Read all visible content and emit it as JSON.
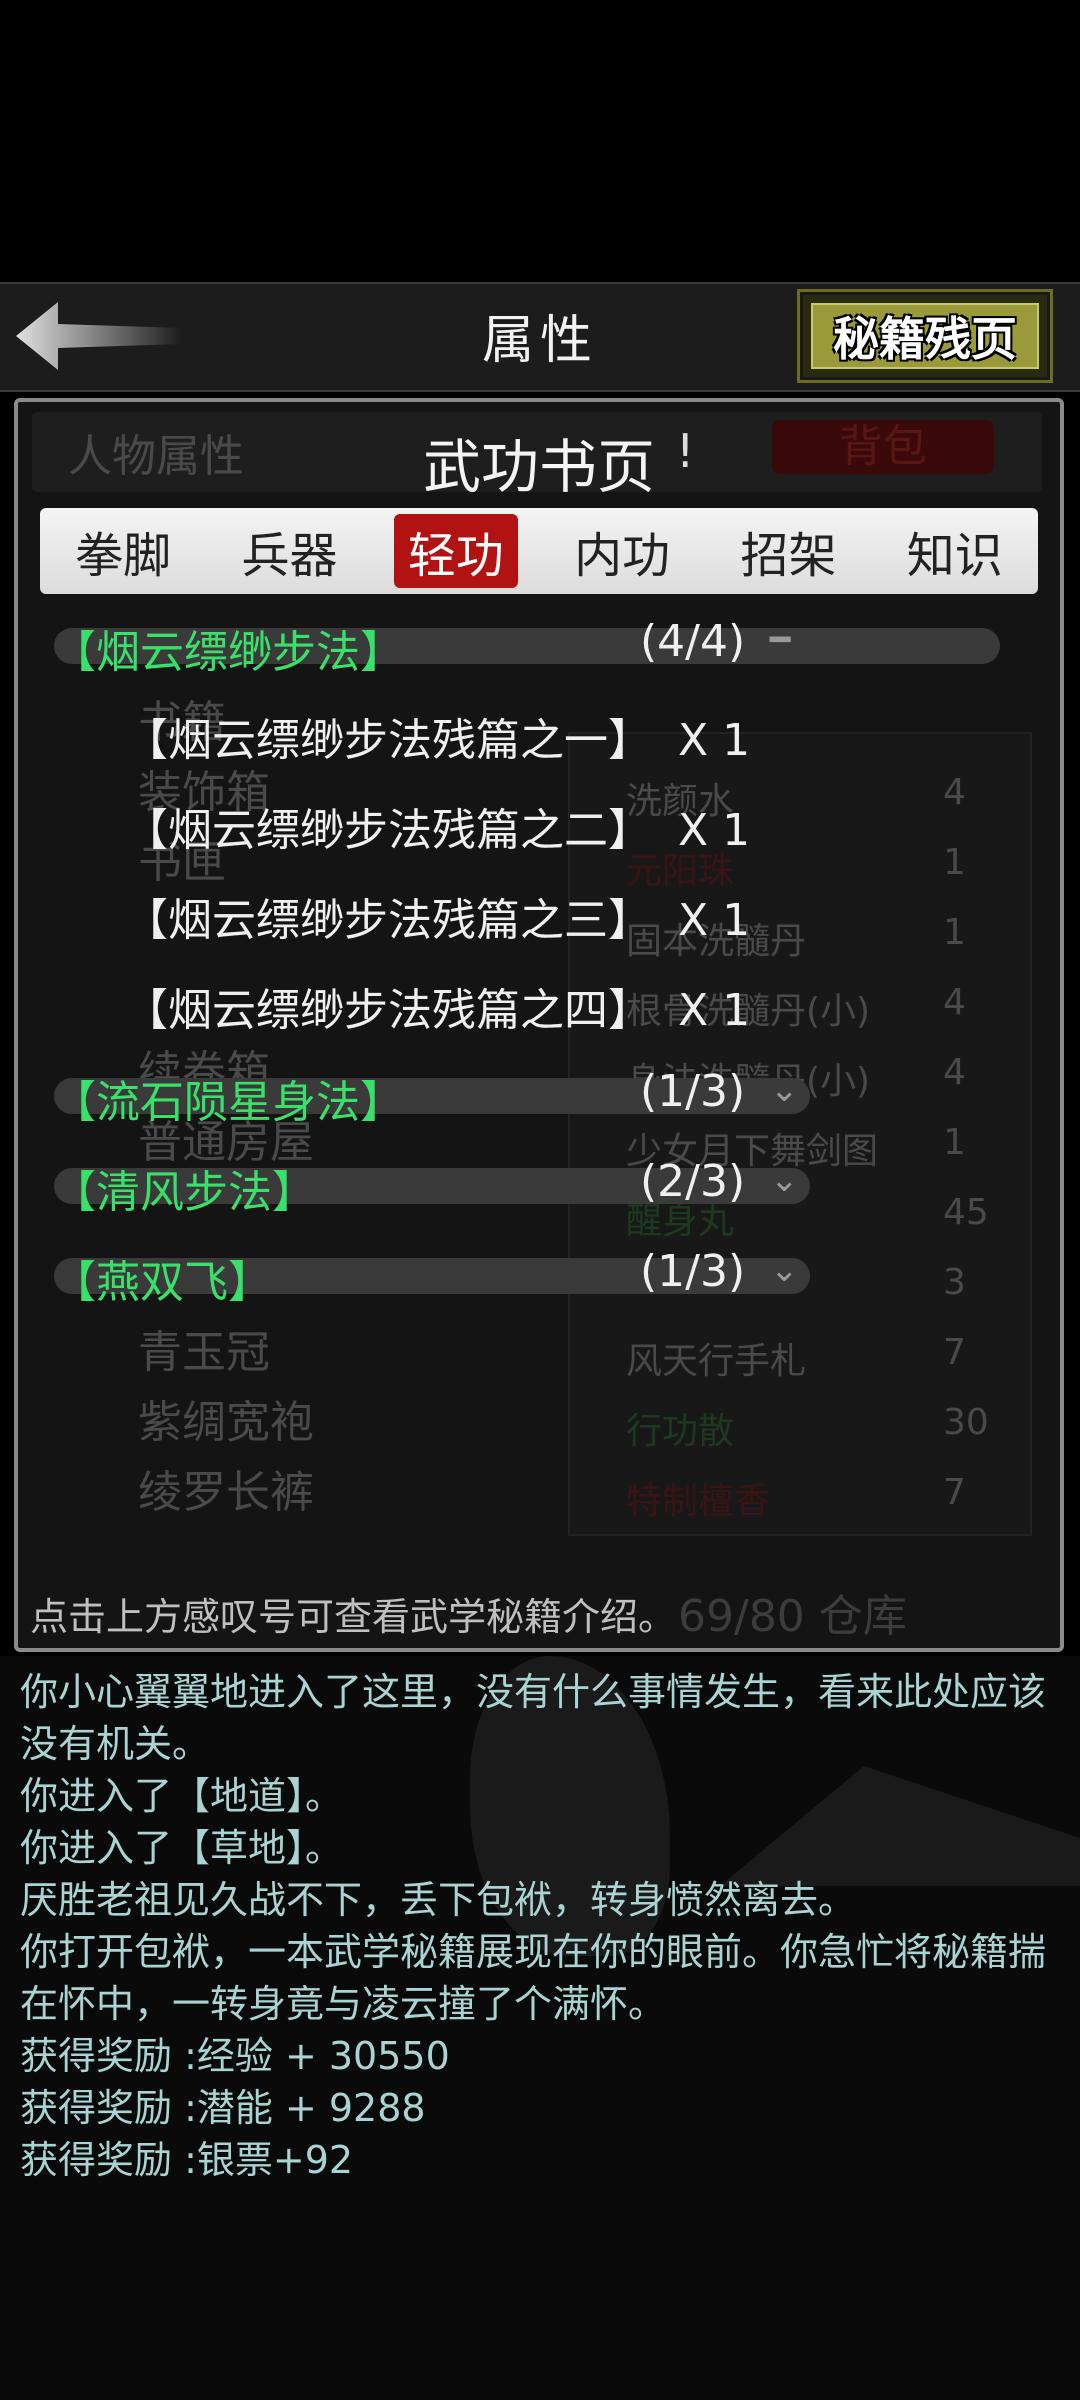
{
  "header": {
    "title": "属性",
    "fragments_button": "秘籍残页"
  },
  "background": {
    "tab_attributes": "人物属性",
    "tab_bag": "背包",
    "equip_list": [
      "书籍",
      "装饰箱",
      "书匣",
      "续卷箱",
      "普通房屋",
      "青玉冠",
      "紫绸宽袍",
      "绫罗长裤"
    ],
    "inventory": [
      {
        "name": "洗颜水",
        "count": "4"
      },
      {
        "name": "元阳珠",
        "count": "1"
      },
      {
        "name": "固本洗髓丹",
        "count": "1"
      },
      {
        "name": "根骨洗髓丹(小)",
        "count": "4"
      },
      {
        "name": "身法洗髓丹(小)",
        "count": "4"
      },
      {
        "name": "少女月下舞剑图",
        "count": "1"
      },
      {
        "name": "醒身丸",
        "count": "45"
      },
      {
        "name": "",
        "count": "3"
      },
      {
        "name": "风天行手札",
        "count": "7"
      },
      {
        "name": "行功散",
        "count": "30"
      },
      {
        "name": "特制檀香",
        "count": "7"
      }
    ],
    "capacity": "69/80 仓库"
  },
  "modal": {
    "title": "武功书页",
    "info_icon": "!",
    "tabs": [
      {
        "label": "拳脚",
        "active": false
      },
      {
        "label": "兵器",
        "active": false
      },
      {
        "label": "轻功",
        "active": true
      },
      {
        "label": "内功",
        "active": false
      },
      {
        "label": "招架",
        "active": false
      },
      {
        "label": "知识",
        "active": false
      }
    ],
    "groups": [
      {
        "name": "【烟云缥缈步法】",
        "count": "(4/4)",
        "expanded": true,
        "items": [
          {
            "name": "【烟云缥缈步法残篇之一】",
            "qty": "X 1"
          },
          {
            "name": "【烟云缥缈步法残篇之二】",
            "qty": "X 1"
          },
          {
            "name": "【烟云缥缈步法残篇之三】",
            "qty": "X 1"
          },
          {
            "name": "【烟云缥缈步法残篇之四】",
            "qty": "X 1"
          }
        ]
      },
      {
        "name": "【流石陨星身法】",
        "count": "(1/3)",
        "expanded": false
      },
      {
        "name": "【清风步法】",
        "count": "(2/3)",
        "expanded": false
      },
      {
        "name": "【燕双飞】",
        "count": "(1/3)",
        "expanded": false
      }
    ],
    "hint": "点击上方感叹号可查看武学秘籍介绍。"
  },
  "log": [
    "你小心翼翼地进入了这里，没有什么事情发生，看来此处应该没有机关。",
    "你进入了【地道】。",
    "你进入了【草地】。",
    "厌胜老祖见久战不下，丢下包袱，转身愤然离去。",
    "你打开包袱，一本武学秘籍展现在你的眼前。你急忙将秘籍揣在怀中，一转身竟与凌云撞了个满怀。",
    "获得奖励 :经验 + 30550",
    "获得奖励 :潜能 + 9288",
    "获得奖励 :银票+92"
  ],
  "colors": {
    "group_name": "#39e06a",
    "active_tab": "#b31212",
    "log_text": "#aad3d3"
  }
}
